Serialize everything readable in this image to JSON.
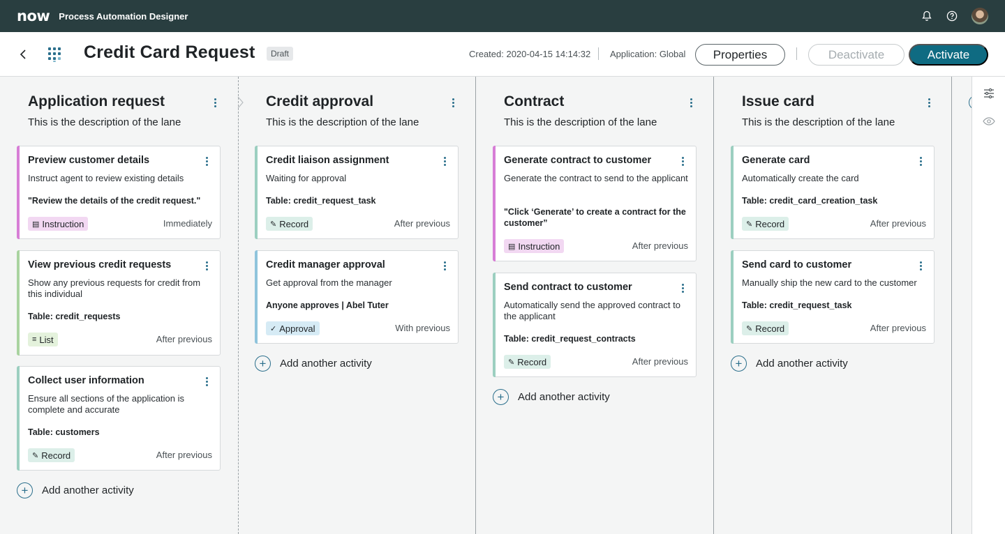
{
  "topbar": {
    "logo": "now",
    "app_title": "Process Automation Designer",
    "icons": [
      "bell-icon",
      "help-icon",
      "user-avatar"
    ]
  },
  "header": {
    "title": "Credit Card Request",
    "status_badge": "Draft",
    "created": "Created: 2020-04-15 14:14:32",
    "application": "Application: Global",
    "properties_label": "Properties",
    "deactivate_label": "Deactivate",
    "activate_label": "Activate"
  },
  "colors": {
    "topbar": "#293e40",
    "primary": "#0f6b82",
    "instruction_tag": "#f2d8f2",
    "record_tag": "#dcefe9",
    "approval_tag": "#d6ebf5",
    "list_tag": "#e4f2dc"
  },
  "lanes": [
    {
      "title": "Application request",
      "description": "This is the description of the lane",
      "add_label": "Add another activity",
      "cards": [
        {
          "title": "Preview customer details",
          "description": "Instruct agent to review existing details",
          "extra": "\"Review the details of the credit request.\"",
          "tag": "Instruction",
          "timing": "Immediately"
        },
        {
          "title": "View previous credit requests",
          "description": "Show any previous requests for credit from this individual",
          "extra": "Table: credit_requests",
          "tag": "List",
          "timing": "After previous"
        },
        {
          "title": "Collect user information",
          "description": "Ensure all sections of the application is complete and accurate",
          "extra": "Table: customers",
          "tag": "Record",
          "timing": "After previous"
        }
      ]
    },
    {
      "title": "Credit approval",
      "description": "This is the description of the lane",
      "add_label": "Add another activity",
      "cards": [
        {
          "title": "Credit liaison assignment",
          "description": "Waiting for approval",
          "extra": "Table: credit_request_task",
          "tag": "Record",
          "timing": "After previous"
        },
        {
          "title": "Credit manager approval",
          "description": "Get approval from the manager",
          "extra": "Anyone approves | Abel Tuter",
          "tag": "Approval",
          "timing": "With previous"
        }
      ]
    },
    {
      "title": "Contract",
      "description": "This is the description of the lane",
      "add_label": "Add another activity",
      "cards": [
        {
          "title": "Generate contract to customer",
          "description": "Generate the contract to send to the applicant",
          "extra": "\"Click ‘Generate’ to create a contract for the customer”",
          "tag": "Instruction",
          "timing": "After previous"
        },
        {
          "title": "Send contract to customer",
          "description": "Automatically send the approved contract to the applicant",
          "extra": "Table: credit_request_contracts",
          "tag": "Record",
          "timing": "After previous"
        }
      ]
    },
    {
      "title": "Issue card",
      "description": "This is the description of the lane",
      "add_label": "Add another activity",
      "cards": [
        {
          "title": "Generate card",
          "description": "Automatically create the card",
          "extra": "Table: credit_card_creation_task",
          "tag": "Record",
          "timing": "After previous"
        },
        {
          "title": "Send card to customer",
          "description": "Manually ship the new card to the customer",
          "extra": "Table: credit_request_task",
          "tag": "Record",
          "timing": "After previous"
        }
      ]
    }
  ],
  "rail": {
    "icons": [
      "filter-settings-icon",
      "eye-icon"
    ]
  }
}
